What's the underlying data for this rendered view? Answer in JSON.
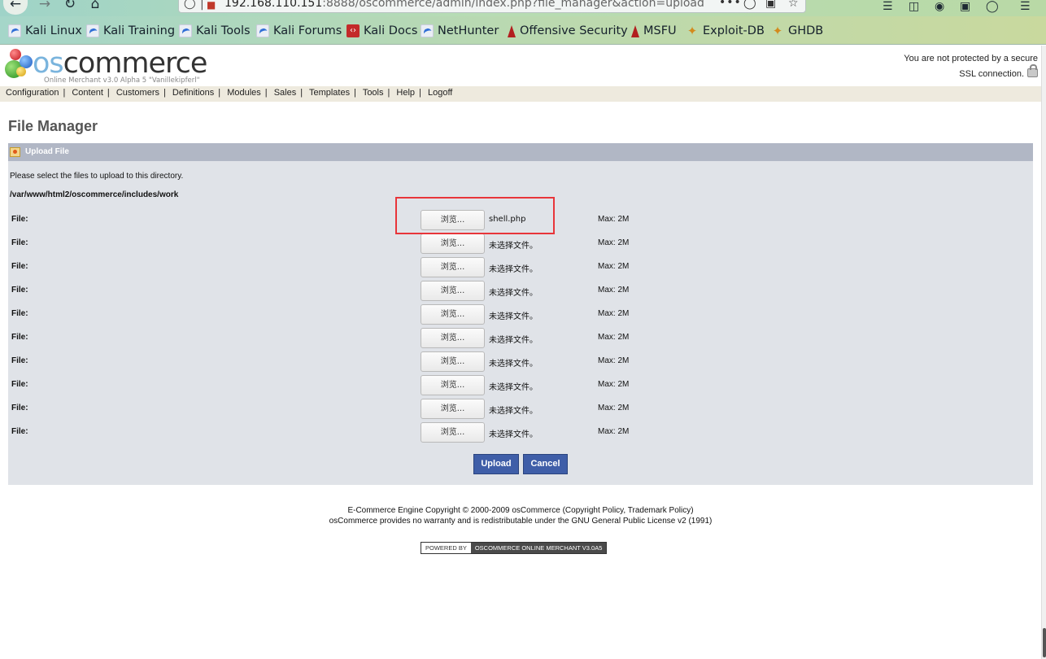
{
  "browser": {
    "url_host": "192.168.110.151",
    "url_rest": ":8888/oscommerce/admin/index.php?file_manager&action=upload",
    "overflow_label": "•••"
  },
  "bookmarks": [
    {
      "label": "Kali Linux",
      "icon": "kali-dragon-icon"
    },
    {
      "label": "Kali Training",
      "icon": "kali-dragon-icon"
    },
    {
      "label": "Kali Tools",
      "icon": "kali-dragon-icon"
    },
    {
      "label": "Kali Forums",
      "icon": "kali-dragon-icon"
    },
    {
      "label": "Kali Docs",
      "icon": "kali-docs-icon"
    },
    {
      "label": "NetHunter",
      "icon": "kali-dragon-icon"
    },
    {
      "label": "Offensive Security",
      "icon": "offsec-icon"
    },
    {
      "label": "MSFU",
      "icon": "offsec-icon"
    },
    {
      "label": "Exploit-DB",
      "icon": "exploit-db-icon"
    },
    {
      "label": "GHDB",
      "icon": "exploit-db-icon"
    }
  ],
  "header": {
    "logo_os": "os",
    "logo_commerce": "commerce",
    "tagline": "Online Merchant v3.0 Alpha 5 \"Vanillekipferl\"",
    "ssl_line1": "You are not protected by a secure",
    "ssl_line2": "SSL connection."
  },
  "menu": [
    "Configuration",
    "Content",
    "Customers",
    "Definitions",
    "Modules",
    "Sales",
    "Templates",
    "Tools",
    "Help",
    "Logoff"
  ],
  "page_title": "File Manager",
  "panel": {
    "heading": "Upload File",
    "intro": "Please select the files to upload to this directory.",
    "directory": "/var/www/html2/oscommerce/includes/work",
    "rows": [
      {
        "label": "File:",
        "button": "浏览...",
        "filename": "shell.php",
        "max": "Max: 2M"
      },
      {
        "label": "File:",
        "button": "浏览...",
        "filename": "未选择文件。",
        "max": "Max: 2M"
      },
      {
        "label": "File:",
        "button": "浏览...",
        "filename": "未选择文件。",
        "max": "Max: 2M"
      },
      {
        "label": "File:",
        "button": "浏览...",
        "filename": "未选择文件。",
        "max": "Max: 2M"
      },
      {
        "label": "File:",
        "button": "浏览...",
        "filename": "未选择文件。",
        "max": "Max: 2M"
      },
      {
        "label": "File:",
        "button": "浏览...",
        "filename": "未选择文件。",
        "max": "Max: 2M"
      },
      {
        "label": "File:",
        "button": "浏览...",
        "filename": "未选择文件。",
        "max": "Max: 2M"
      },
      {
        "label": "File:",
        "button": "浏览...",
        "filename": "未选择文件。",
        "max": "Max: 2M"
      },
      {
        "label": "File:",
        "button": "浏览...",
        "filename": "未选择文件。",
        "max": "Max: 2M"
      },
      {
        "label": "File:",
        "button": "浏览...",
        "filename": "未选择文件。",
        "max": "Max: 2M"
      }
    ],
    "upload_label": "Upload",
    "cancel_label": "Cancel"
  },
  "footer": {
    "line1": "E-Commerce Engine Copyright © 2000-2009 osCommerce (Copyright Policy, Trademark Policy)",
    "line2": "osCommerce provides no warranty and is redistributable under the GNU General Public License v2 (1991)",
    "powered_by": "POWERED BY",
    "powered_name": "OSCOMMERCE ONLINE MERCHANT V3.0A5"
  },
  "colors": {
    "accent_button": "#3f5ea8",
    "panel_header": "#b1b7c5",
    "panel_body": "#e0e3e8",
    "highlight_box": "#e8353a"
  }
}
